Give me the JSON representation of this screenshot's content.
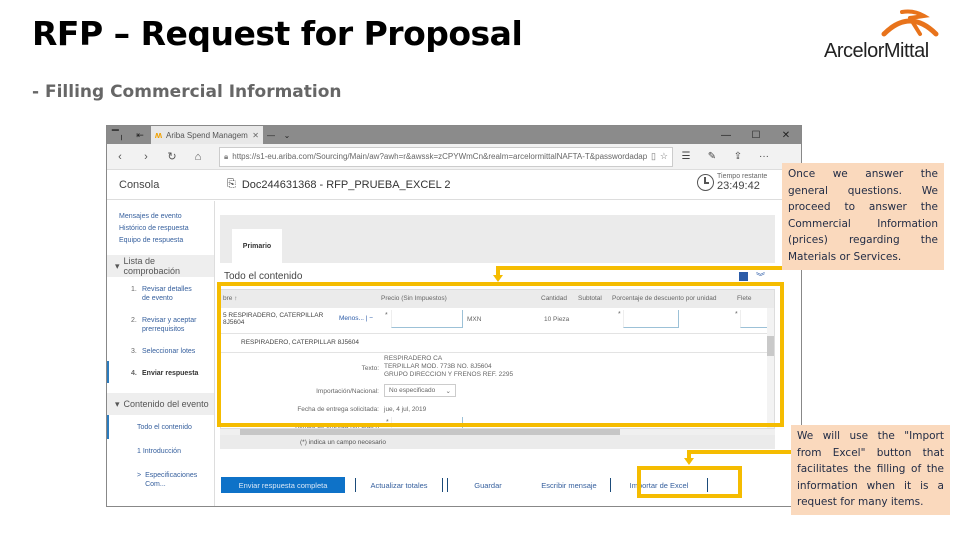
{
  "slide": {
    "title": "RFP – Request for Proposal",
    "subtitle": "- Filling Commercial Information",
    "logo_text": "ArcelorMittal",
    "brand_color": "#e8731b",
    "highlight_color": "#f5bc00"
  },
  "browser": {
    "tab": {
      "favicon": "ariba-icon",
      "label": "Ariba Spend Manageme",
      "close": "✕"
    },
    "new_tab": "+",
    "tab_menu": "⌄",
    "window_controls": [
      "—",
      "☐",
      "✕"
    ],
    "nav": {
      "back": "‹",
      "forward": "›",
      "refresh": "↻",
      "home": "⌂"
    },
    "url": "https://s1-eu.ariba.com/Sourcing/Main/aw?awh=r&awssk=zCPYWmCn&realm=arcelormittalNAFTA-T&passwordadapter",
    "toolbar_icons": [
      "☆",
      "☰",
      "✎",
      "⇪",
      "···"
    ]
  },
  "app": {
    "console_label": "Consola",
    "doc_title": "Doc244631368 - RFP_PRUEBA_EXCEL 2",
    "timer_label": "Tiempo restante",
    "timer_value": "23:49:42"
  },
  "sidebar": {
    "links": [
      "Mensajes de evento",
      "Histórico de respuesta",
      "Equipo de respuesta"
    ],
    "checklist_title": "Lista de comprobación",
    "steps": [
      {
        "num": "1.",
        "label": "Revisar detalles de evento"
      },
      {
        "num": "2.",
        "label": "Revisar y aceptar prerrequisitos"
      },
      {
        "num": "3.",
        "label": "Seleccionar lotes"
      },
      {
        "num": "4.",
        "label": "Enviar respuesta"
      }
    ],
    "content_title": "Contenido del evento",
    "content_items": [
      "Todo el contenido",
      "1  Introducción"
    ],
    "content_sub": {
      "chevron": ">",
      "label": "Especificaciones Com..."
    }
  },
  "main": {
    "tab_primary": "Primario",
    "section_title": "Todo el contenido",
    "columns": {
      "name": "bre ↑",
      "price": "Precio (Sin Impuestos)",
      "quantity": "Cantidad",
      "subtotal": "Subtotal",
      "discount": "Porcentaje de descuento por unidad",
      "freight": "Flete"
    },
    "item": {
      "name": "5  RESPIRADERO, CATERPILLAR 8J5604",
      "menu_link": "Menos... | −",
      "price_required": "*",
      "currency": "MXN",
      "quantity": "10 Pieza",
      "discount_required": "*",
      "freight_required": "*",
      "description": "RESPIRADERO, CATERPILLAR 8J5604"
    },
    "details": {
      "text_label": "Texto:",
      "text_value": [
        "RESPIRADERO                CA",
        "TERPILLAR MOD. 773B          NO. 8J5604",
        "GRUPO DIRECCION Y FRENOS REF. 2295"
      ],
      "import_label": "Importación/Nacional:",
      "import_value": "No especificado",
      "date_label": "Fecha de entrega solicitada:",
      "date_value": "jue, 4 jul, 2019",
      "leadtime_label": "Tiempo de entrega (en días h",
      "leadtime_required": "*"
    },
    "required_note": "(*) indica un campo necesario"
  },
  "actions": {
    "submit": "Enviar respuesta completa",
    "update_totals": "Actualizar totales",
    "save": "Guardar",
    "message": "Escribir mensaje",
    "import_excel": "Importar de Excel"
  },
  "callouts": {
    "top": "Once we answer the general questions. We proceed to answer the Commercial Information (prices) regarding the Materials or Services.",
    "bottom": "We will use the \"Import from Excel\" button that facilitates the filling of the information when it is a request for many items."
  }
}
